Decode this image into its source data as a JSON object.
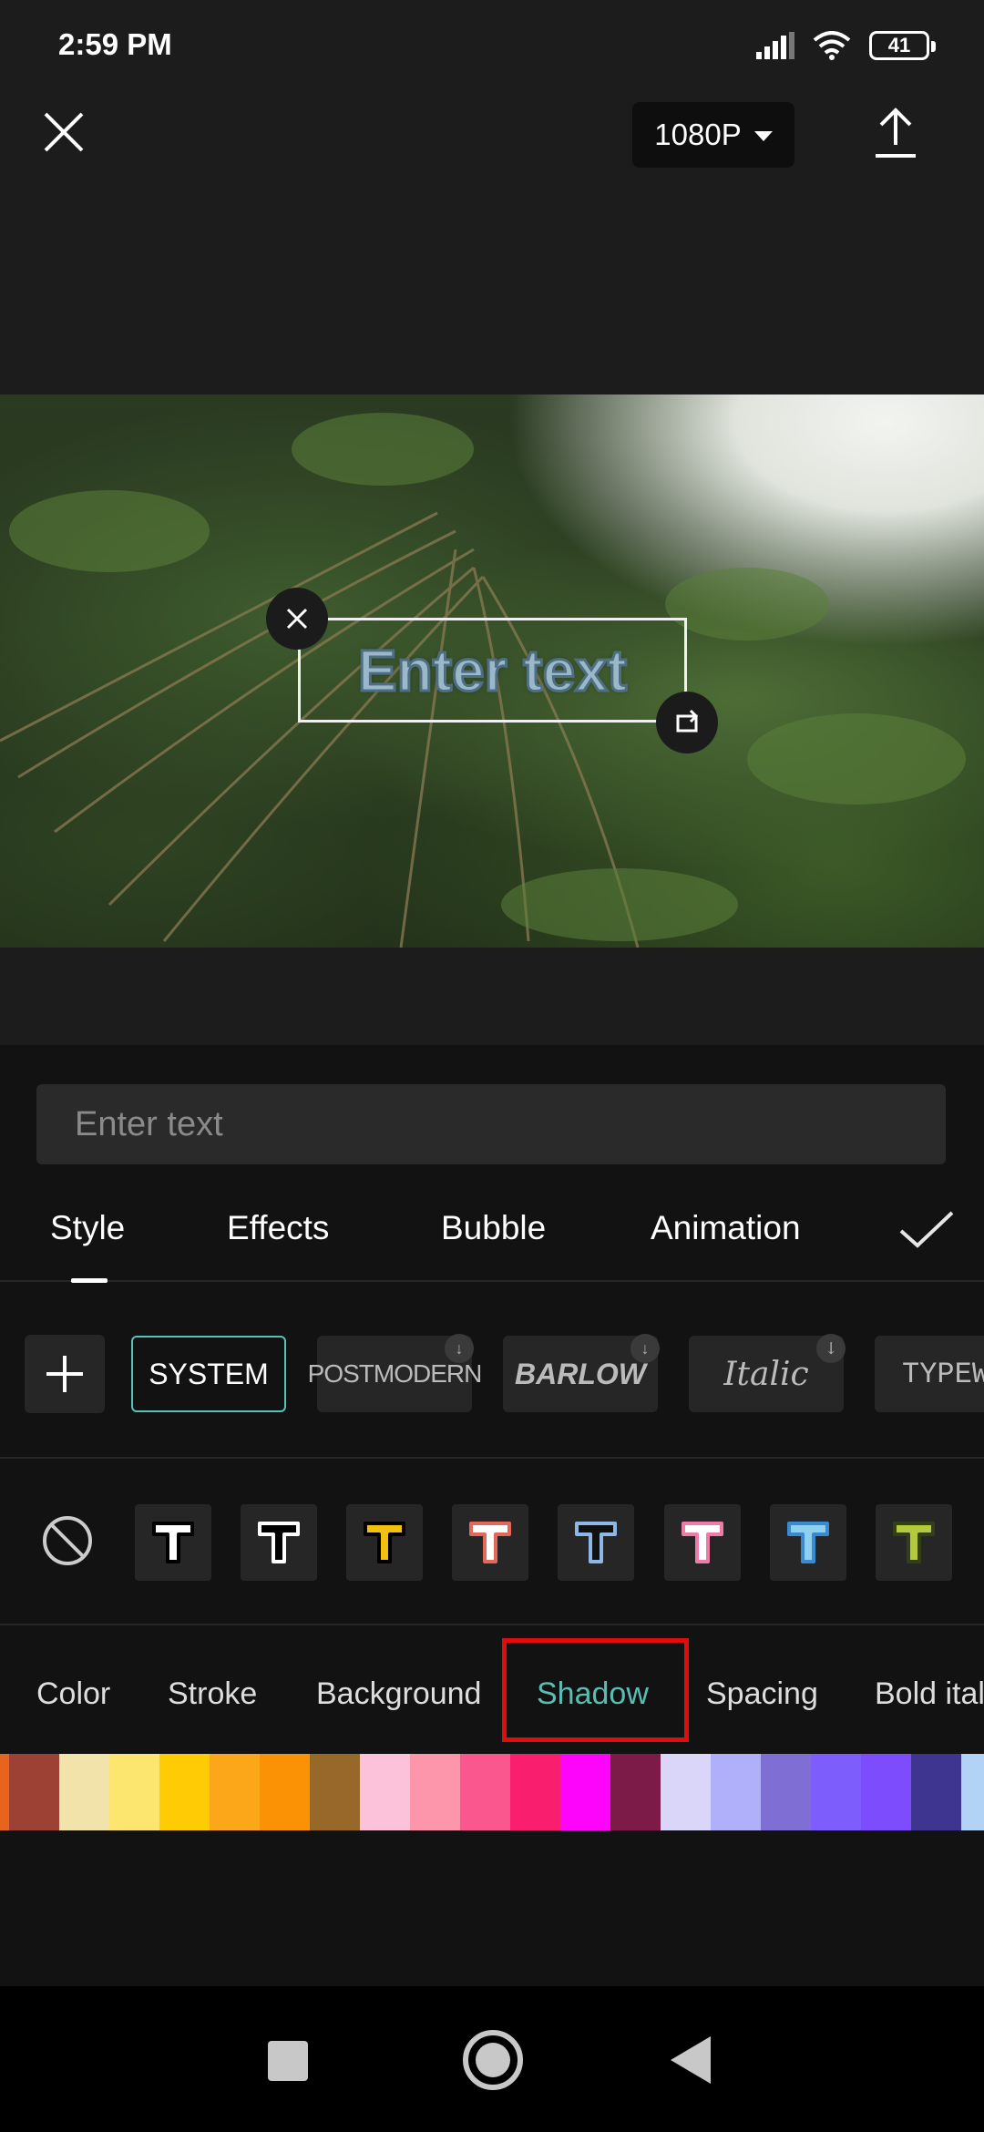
{
  "status_bar": {
    "time": "2:59 PM",
    "battery": "41"
  },
  "toolbar": {
    "resolution": "1080P"
  },
  "preview": {
    "overlay_text": "Enter text"
  },
  "editor": {
    "input_placeholder": "Enter text",
    "tabs": [
      "Style",
      "Effects",
      "Bubble",
      "Animation"
    ],
    "active_tab": "Style"
  },
  "fonts": {
    "items": [
      "SYSTEM",
      "POSTMODERN",
      "BARLOW",
      "Italic",
      "TYPEW"
    ],
    "selected": "SYSTEM"
  },
  "presets": [
    {
      "fill": "#ffffff",
      "stroke": "#000000"
    },
    {
      "fill": "#000000",
      "stroke": "#ffffff"
    },
    {
      "fill": "#f2c10f",
      "stroke": "#000000"
    },
    {
      "fill": "#ffffff",
      "stroke": "#e2685a"
    },
    {
      "fill": "#111111",
      "stroke": "#8fb7e6"
    },
    {
      "fill": "#ffffff",
      "stroke": "#f07aa8"
    },
    {
      "fill": "#8fd0ef",
      "stroke": "#3a8ad1"
    },
    {
      "fill": "#b4c93c",
      "stroke": "#334015"
    }
  ],
  "subtabs": {
    "items": [
      "Color",
      "Stroke",
      "Background",
      "Shadow",
      "Spacing",
      "Bold ital"
    ],
    "active": "Shadow"
  },
  "swatch_colors": [
    "#e8641c",
    "#9c4133",
    "#f1e3a9",
    "#fde66f",
    "#fecb05",
    "#fca619",
    "#fb9104",
    "#98672a",
    "#fcc2d9",
    "#fd95ab",
    "#f9578d",
    "#f91f6e",
    "#fe05fb",
    "#7c1a48",
    "#d9d6fa",
    "#b0affa",
    "#7f6fd5",
    "#7d5dfb",
    "#7c4cfd",
    "#3e3590",
    "#b2d2f6"
  ],
  "colors": {
    "accent": "#5bbdb1",
    "highlight": "#e10c0c",
    "panel_bg": "#121212"
  }
}
